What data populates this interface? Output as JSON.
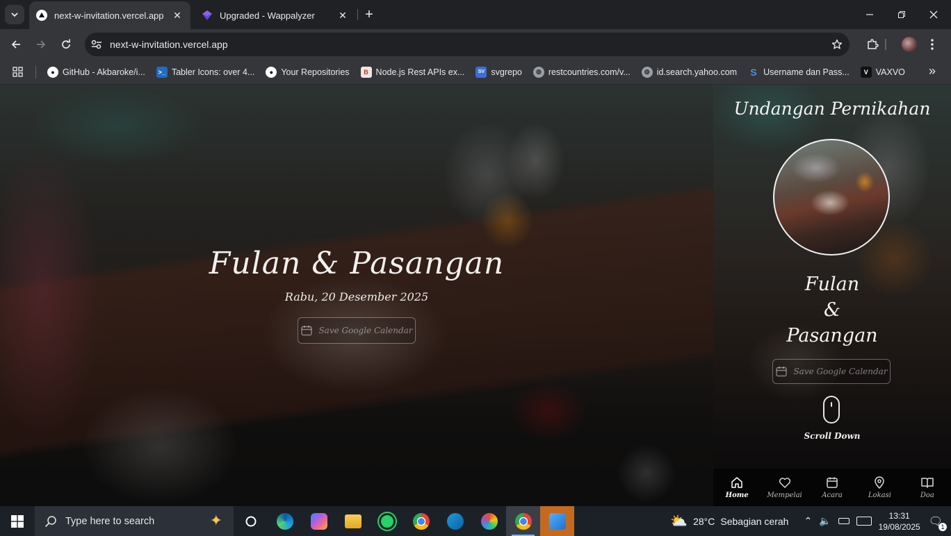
{
  "browser": {
    "tabs": [
      {
        "title": "next-w-invitation.vercel.app",
        "active": true
      },
      {
        "title": "Upgraded - Wappalyzer",
        "active": false
      }
    ],
    "url": "next-w-invitation.vercel.app",
    "bookmarks": [
      {
        "label": "GitHub - Akbaroke/i...",
        "icon": "github-icon",
        "color": "#ffffff"
      },
      {
        "label": "Tabler Icons: over 4...",
        "icon": "tabler-icon",
        "color": "#206bc4"
      },
      {
        "label": "Your Repositories",
        "icon": "github-icon",
        "color": "#ffffff"
      },
      {
        "label": "Node.js Rest APIs ex...",
        "icon": "bezkoder-icon",
        "color": "#c0392b"
      },
      {
        "label": "svgrepo",
        "icon": "svgrepo-icon",
        "color": "#3b6fd8"
      },
      {
        "label": "restcountries.com/v...",
        "icon": "globe-icon",
        "color": "#9aa0a6"
      },
      {
        "label": "id.search.yahoo.com",
        "icon": "globe-icon",
        "color": "#9aa0a6"
      },
      {
        "label": "Username dan Pass...",
        "icon": "s-icon",
        "color": "#4a90e2"
      },
      {
        "label": "VAXVO",
        "icon": "v-icon",
        "color": "#111111"
      }
    ]
  },
  "hero": {
    "names": "Fulan & Pasangan",
    "date": "Rabu, 20 Desember 2025",
    "calendar_button": "Save Google Calendar"
  },
  "panel": {
    "title": "Undangan Pernikahan",
    "name_1": "Fulan",
    "ampersand": "&",
    "name_2": "Pasangan",
    "calendar_button": "Save Google Calendar",
    "scroll_label": "Scroll Down",
    "nav": [
      {
        "label": "Home",
        "icon": "home-icon",
        "active": true
      },
      {
        "label": "Mempelai",
        "icon": "heart-icon",
        "active": false
      },
      {
        "label": "Acara",
        "icon": "calendar-icon",
        "active": false
      },
      {
        "label": "Lokasi",
        "icon": "map-pin-icon",
        "active": false
      },
      {
        "label": "Doa",
        "icon": "book-icon",
        "active": false
      }
    ]
  },
  "taskbar": {
    "search_placeholder": "Type here to search",
    "weather_temp": "28°C",
    "weather_text": "Sebagian cerah",
    "time": "13:31",
    "date": "19/08/2025",
    "notification_count": "1"
  }
}
